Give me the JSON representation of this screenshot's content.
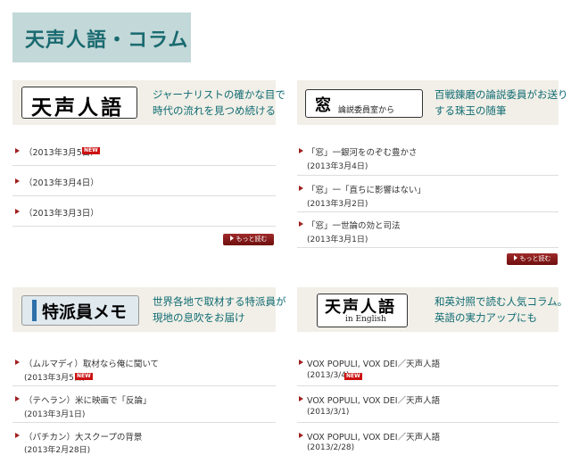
{
  "page_title": "天声人語・コラム",
  "more_label": "もっと読む",
  "new_badge": "NEW",
  "sections": {
    "tensei": {
      "logo_text": "天声人語",
      "description": [
        "ジャーナリストの確かな目で",
        "時代の流れを見つめ続ける"
      ],
      "items": [
        {
          "text": "（2013年3月5日）"
        },
        {
          "text": "（2013年3月4日）"
        },
        {
          "text": "（2013年3月3日）"
        }
      ]
    },
    "mado": {
      "logo_text": "窓",
      "logo_subtext": "論説委員室から",
      "description": [
        "百戦錬磨の論説委員がお送り",
        "する珠玉の随筆"
      ],
      "items": [
        {
          "text": "「窓」一銀河をのぞむ豊かさ",
          "date": "(2013年3月4日)"
        },
        {
          "text": "「窓」一「直ちに影響はない」",
          "date": "(2013年3月2日)"
        },
        {
          "text": "「窓」一世論の効と司法",
          "date": "(2013年3月1日)"
        }
      ]
    },
    "tokuha": {
      "logo_text": "特派員メモ",
      "description": [
        "世界各地で取材する特派員が",
        "現地の息吹をお届け"
      ],
      "items": [
        {
          "text": "（ムルマディ）取材なら俺に聞いて",
          "date": "(2013年3月5日)"
        },
        {
          "text": "（テヘラン）米に映画で「反論」",
          "date": "(2013年3月1日)"
        },
        {
          "text": "（パチカン）大スクープの背景",
          "date": "(2013年2月28日)"
        }
      ]
    },
    "english": {
      "logo_text": "天声人語",
      "logo_subtext": "in English",
      "description": [
        "和英対照で読む人気コラム。",
        "英語の実力アップにも"
      ],
      "items": [
        {
          "text": "VOX POPULI, VOX DEI／天声人語",
          "date": "(2013/3/4)"
        },
        {
          "text": "VOX POPULI, VOX DEI／天声人語",
          "date": "(2013/3/1)"
        },
        {
          "text": "VOX POPULI, VOX DEI／天声人語",
          "date": "(2013/2/28)"
        }
      ]
    }
  }
}
